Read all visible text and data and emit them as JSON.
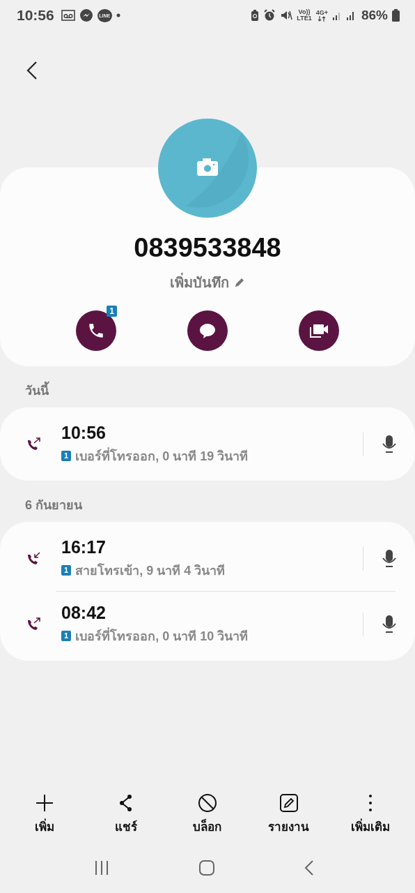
{
  "status_bar": {
    "time": "10:56",
    "line_logo": "LINE",
    "volte": "Vo))",
    "lte": "LTE1",
    "network": "4G+",
    "battery": "86%"
  },
  "contact": {
    "number": "0839533848",
    "note_action": "เพิ่มบันทึก",
    "call_badge": "1"
  },
  "actions": [
    {
      "kind": "call"
    },
    {
      "kind": "message"
    },
    {
      "kind": "video"
    }
  ],
  "groups": [
    {
      "date": "วันนี้",
      "calls": [
        {
          "kind": "outgoing",
          "time": "10:56",
          "sim": "1",
          "detail": "เบอร์ที่โทรออก, 0 นาที 19 วินาที"
        }
      ]
    },
    {
      "date": "6 กันยายน",
      "calls": [
        {
          "kind": "incoming",
          "time": "16:17",
          "sim": "1",
          "detail": "สายโทรเข้า, 9 นาที 4 วินาที"
        },
        {
          "kind": "outgoing",
          "time": "08:42",
          "sim": "1",
          "detail": "เบอร์ที่โทรออก, 0 นาที 10 วินาที"
        }
      ]
    }
  ],
  "toolbar": [
    {
      "kind": "add",
      "label": "เพิ่ม"
    },
    {
      "kind": "share",
      "label": "แชร์"
    },
    {
      "kind": "block",
      "label": "บล็อก"
    },
    {
      "kind": "report",
      "label": "รายงาน"
    },
    {
      "kind": "more",
      "label": "เพิ่มเติม"
    }
  ]
}
